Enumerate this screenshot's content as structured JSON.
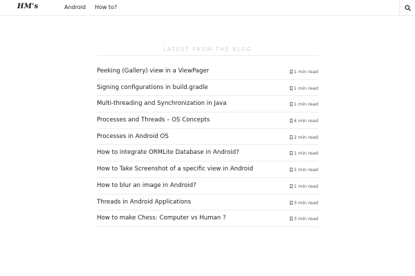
{
  "header": {
    "logo": "HM's",
    "nav": [
      "Android",
      "How to?"
    ],
    "search_icon": "search-icon"
  },
  "main": {
    "section_title": "LATEST FROM THE BLOG",
    "posts": [
      {
        "title": "Peeking (Gallery) view in a ViewPager",
        "read_time": "1 min read"
      },
      {
        "title": "Signing configurations in build.gradle",
        "read_time": "1 min read"
      },
      {
        "title": "Multi-threading and Synchronization in Java",
        "read_time": "1 min read"
      },
      {
        "title": "Processes and Threads – OS Concepts",
        "read_time": "4 min read"
      },
      {
        "title": "Processes in Android OS",
        "read_time": "2 min read"
      },
      {
        "title": "How to integrate ORMLite Database in Android?",
        "read_time": "1 min read"
      },
      {
        "title": "How to Take Screenshot of a specific view in Android",
        "read_time": "1 min read"
      },
      {
        "title": "How to blur an image in Android?",
        "read_time": "1 min read"
      },
      {
        "title": "Threads in Android Applications",
        "read_time": "3 min read"
      },
      {
        "title": "How to make Chess: Computer vs Human ?",
        "read_time": "3 min read"
      }
    ],
    "read_icon": "bookmark-icon"
  },
  "colors": {
    "text": "#222222",
    "muted_heading": "#d2d2d2",
    "divider": "#ececec"
  }
}
